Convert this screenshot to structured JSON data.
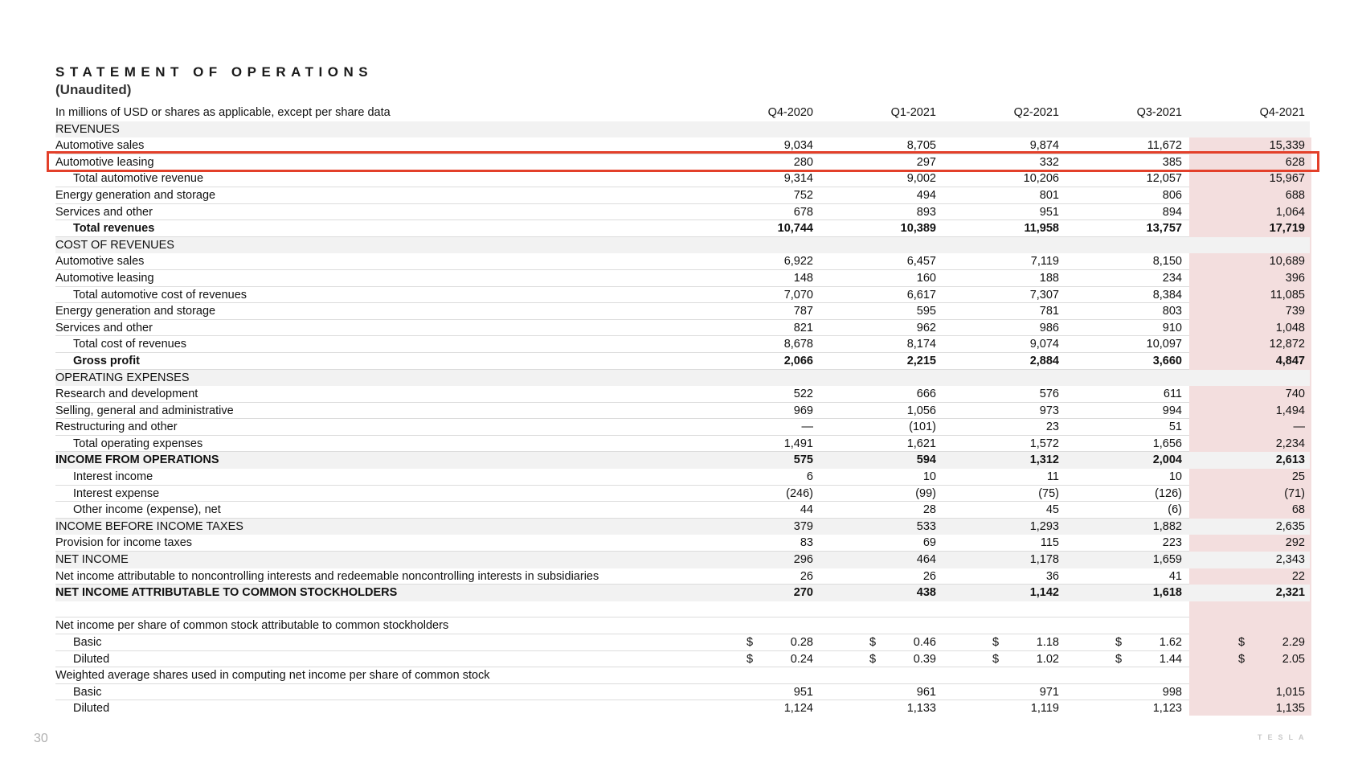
{
  "page": {
    "title": "STATEMENT OF OPERATIONS",
    "subtitle": "(Unaudited)",
    "page_number": "30",
    "brand": "TESLA"
  },
  "colors": {
    "highlight_box": "#e3402a",
    "current_quarter_column": "#f3dede",
    "row_shade": "#f2f2f2"
  },
  "header": {
    "label": "In millions of USD or shares as applicable, except per share data",
    "columns": [
      "Q4-2020",
      "Q1-2021",
      "Q2-2021",
      "Q3-2021",
      "Q4-2021"
    ]
  },
  "rows": [
    {
      "label": "REVENUES",
      "values": [
        "",
        "",
        "",
        "",
        ""
      ]
    },
    {
      "label": "Automotive sales",
      "values": [
        "9,034",
        "8,705",
        "9,874",
        "11,672",
        "15,339"
      ]
    },
    {
      "label": "Automotive leasing",
      "values": [
        "280",
        "297",
        "332",
        "385",
        "628"
      ]
    },
    {
      "label": "Total automotive revenue",
      "values": [
        "9,314",
        "9,002",
        "10,206",
        "12,057",
        "15,967"
      ]
    },
    {
      "label": "Energy generation and storage",
      "values": [
        "752",
        "494",
        "801",
        "806",
        "688"
      ]
    },
    {
      "label": "Services and other",
      "values": [
        "678",
        "893",
        "951",
        "894",
        "1,064"
      ]
    },
    {
      "label": "Total revenues",
      "values": [
        "10,744",
        "10,389",
        "11,958",
        "13,757",
        "17,719"
      ]
    },
    {
      "label": "COST OF REVENUES",
      "values": [
        "",
        "",
        "",
        "",
        ""
      ]
    },
    {
      "label": "Automotive sales",
      "values": [
        "6,922",
        "6,457",
        "7,119",
        "8,150",
        "10,689"
      ]
    },
    {
      "label": "Automotive leasing",
      "values": [
        "148",
        "160",
        "188",
        "234",
        "396"
      ]
    },
    {
      "label": "Total automotive cost of revenues",
      "values": [
        "7,070",
        "6,617",
        "7,307",
        "8,384",
        "11,085"
      ]
    },
    {
      "label": "Energy generation and storage",
      "values": [
        "787",
        "595",
        "781",
        "803",
        "739"
      ]
    },
    {
      "label": "Services and other",
      "values": [
        "821",
        "962",
        "986",
        "910",
        "1,048"
      ]
    },
    {
      "label": "Total cost of revenues",
      "values": [
        "8,678",
        "8,174",
        "9,074",
        "10,097",
        "12,872"
      ]
    },
    {
      "label": "Gross profit",
      "values": [
        "2,066",
        "2,215",
        "2,884",
        "3,660",
        "4,847"
      ]
    },
    {
      "label": "OPERATING EXPENSES",
      "values": [
        "",
        "",
        "",
        "",
        ""
      ]
    },
    {
      "label": "Research and development",
      "values": [
        "522",
        "666",
        "576",
        "611",
        "740"
      ]
    },
    {
      "label": "Selling, general and administrative",
      "values": [
        "969",
        "1,056",
        "973",
        "994",
        "1,494"
      ]
    },
    {
      "label": "Restructuring and other",
      "values": [
        "—",
        "(101)",
        "23",
        "51",
        "—"
      ]
    },
    {
      "label": "Total operating expenses",
      "values": [
        "1,491",
        "1,621",
        "1,572",
        "1,656",
        "2,234"
      ]
    },
    {
      "label": "INCOME FROM OPERATIONS",
      "values": [
        "575",
        "594",
        "1,312",
        "2,004",
        "2,613"
      ]
    },
    {
      "label": "Interest income",
      "values": [
        "6",
        "10",
        "11",
        "10",
        "25"
      ]
    },
    {
      "label": "Interest expense",
      "values": [
        "(246)",
        "(99)",
        "(75)",
        "(126)",
        "(71)"
      ]
    },
    {
      "label": "Other income (expense), net",
      "values": [
        "44",
        "28",
        "45",
        "(6)",
        "68"
      ]
    },
    {
      "label": "INCOME BEFORE INCOME TAXES",
      "values": [
        "379",
        "533",
        "1,293",
        "1,882",
        "2,635"
      ]
    },
    {
      "label": "Provision for income taxes",
      "values": [
        "83",
        "69",
        "115",
        "223",
        "292"
      ]
    },
    {
      "label": "NET INCOME",
      "values": [
        "296",
        "464",
        "1,178",
        "1,659",
        "2,343"
      ]
    },
    {
      "label": "Net income attributable to noncontrolling interests and redeemable noncontrolling interests in subsidiaries",
      "values": [
        "26",
        "26",
        "36",
        "41",
        "22"
      ]
    },
    {
      "label": "NET INCOME ATTRIBUTABLE TO COMMON STOCKHOLDERS",
      "values": [
        "270",
        "438",
        "1,142",
        "1,618",
        "2,321"
      ]
    },
    {
      "label": "",
      "values": [
        "",
        "",
        "",
        "",
        ""
      ]
    },
    {
      "label": "Net income per share of common stock attributable to common stockholders",
      "values": [
        "",
        "",
        "",
        "",
        ""
      ]
    },
    {
      "label": "Basic",
      "currency": "$",
      "values": [
        "0.28",
        "0.46",
        "1.18",
        "1.62",
        "2.29"
      ]
    },
    {
      "label": "Diluted",
      "currency": "$",
      "values": [
        "0.24",
        "0.39",
        "1.02",
        "1.44",
        "2.05"
      ]
    },
    {
      "label": "Weighted average shares used in computing net income per share of common stock",
      "values": [
        "",
        "",
        "",
        "",
        ""
      ]
    },
    {
      "label": "Basic",
      "values": [
        "951",
        "961",
        "971",
        "998",
        "1,015"
      ]
    },
    {
      "label": "Diluted",
      "values": [
        "1,124",
        "1,133",
        "1,119",
        "1,123",
        "1,135"
      ]
    }
  ]
}
